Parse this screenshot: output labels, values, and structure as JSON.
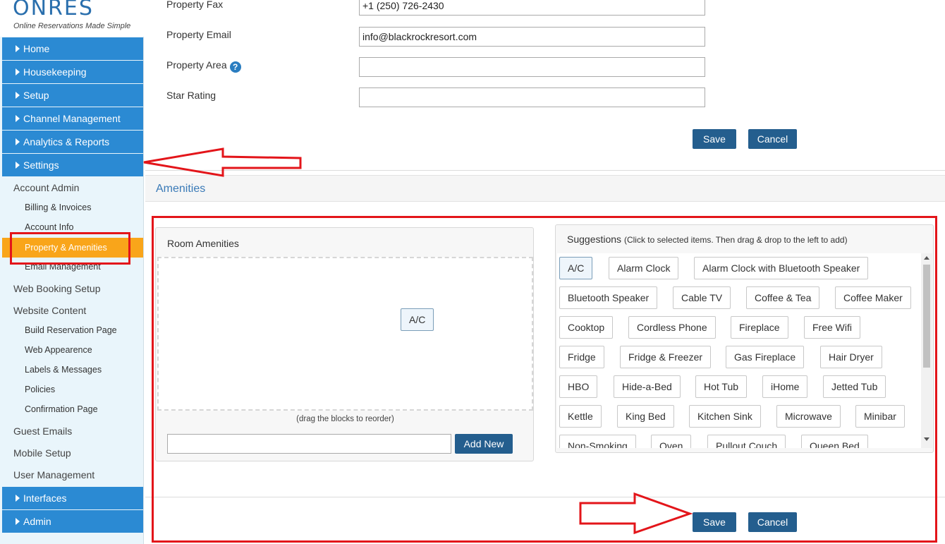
{
  "logo": {
    "brand": "ONRES",
    "tagline": "Online Reservations Made Simple"
  },
  "nav": {
    "main": [
      "Home",
      "Housekeeping",
      "Setup",
      "Channel Management",
      "Analytics & Reports",
      "Settings"
    ],
    "bottom": [
      "Interfaces",
      "Admin"
    ],
    "account_admin": "Account Admin",
    "billing": "Billing & Invoices",
    "account_info": "Account Info",
    "property_amenities": "Property & Amenities",
    "email_management": "Email Management",
    "web_booking_setup": "Web Booking Setup",
    "website_content": "Website Content",
    "website_items": [
      "Build Reservation Page",
      "Web Appearence",
      "Labels & Messages",
      "Policies",
      "Confirmation Page"
    ],
    "guest_emails": "Guest Emails",
    "mobile_setup": "Mobile Setup",
    "user_management": "User Management"
  },
  "form": {
    "fax_label": "Property Fax",
    "fax_value": "+1 (250) 726-2430",
    "email_label": "Property Email",
    "email_value": "info@blackrockresort.com",
    "area_label": "Property Area",
    "area_value": "",
    "star_label": "Star Rating",
    "star_value": "",
    "help_glyph": "?",
    "save_label": "Save",
    "cancel_label": "Cancel"
  },
  "amenities": {
    "section_title": "Amenities",
    "room_panel_title": "Room Amenities",
    "room_items": [
      "A/C"
    ],
    "drag_hint": "(drag the blocks to reorder)",
    "new_value": "",
    "add_new_label": "Add New",
    "suggestions_title": "Suggestions",
    "suggestions_hint": "(Click to selected items. Then drag & drop to the left to add)",
    "suggestions": [
      [
        "A/C",
        "Alarm Clock",
        "Alarm Clock with Bluetooth Speaker"
      ],
      [
        "Bluetooth Speaker",
        "Cable TV",
        "Coffee & Tea",
        "Coffee Maker"
      ],
      [
        "Cooktop",
        "Cordless Phone",
        "Fireplace",
        "Free Wifi"
      ],
      [
        "Fridge",
        "Fridge & Freezer",
        "Gas Fireplace",
        "Hair Dryer"
      ],
      [
        "HBO",
        "Hide-a-Bed",
        "Hot Tub",
        "iHome",
        "Jetted Tub"
      ],
      [
        "Kettle",
        "King Bed",
        "Kitchen Sink",
        "Microwave",
        "Minibar"
      ],
      [
        "Non-Smoking",
        "Oven",
        "Pullout Couch",
        "Queen Bed"
      ]
    ],
    "save_label": "Save",
    "cancel_label": "Cancel"
  },
  "colors": {
    "nav_blue": "#2b8ad3",
    "active_orange": "#f9a51a",
    "button_blue": "#245e8e",
    "annotation_red": "#e3151a"
  }
}
